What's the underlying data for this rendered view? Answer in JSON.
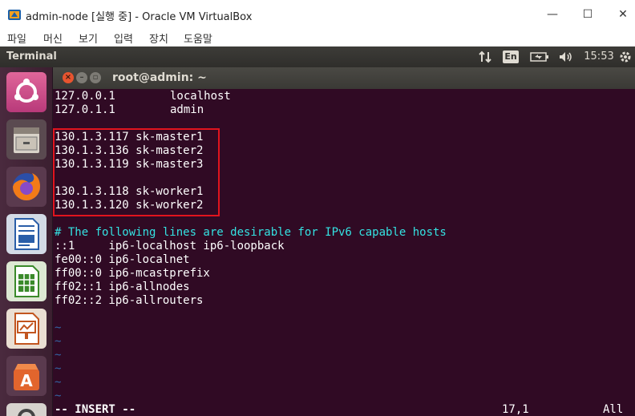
{
  "window": {
    "title": "admin-node [실행 중] - Oracle VM VirtualBox",
    "controls": {
      "minimize": "—",
      "maximize": "☐",
      "close": "✕"
    }
  },
  "menubar": {
    "items": [
      "파일",
      "머신",
      "보기",
      "입력",
      "장치",
      "도움말"
    ]
  },
  "panel": {
    "app_name": "Terminal",
    "keyboard_lang": "En",
    "clock": "15:53"
  },
  "launcher": {
    "items": [
      "ubuntu-dash-icon",
      "files-icon",
      "firefox-icon",
      "libreoffice-writer-icon",
      "libreoffice-calc-icon",
      "libreoffice-impress-icon",
      "software-center-icon",
      "settings-icon"
    ]
  },
  "terminal": {
    "title": "root@admin: ~",
    "hosts": [
      {
        "ip": "127.0.0.1",
        "name": "localhost"
      },
      {
        "ip": "127.0.1.1",
        "name": "admin"
      }
    ],
    "masters": [
      "130.1.3.117 sk-master1",
      "130.1.3.136 sk-master2",
      "130.1.3.119 sk-master3"
    ],
    "workers": [
      "130.1.3.118 sk-worker1",
      "130.1.3.120 sk-worker2"
    ],
    "ipv6_comment": "# The following lines are desirable for IPv6 capable hosts",
    "ipv6_lines": [
      "::1     ip6-localhost ip6-loopback",
      "fe00::0 ip6-localnet",
      "ff00::0 ip6-mcastprefix",
      "ff02::1 ip6-allnodes",
      "ff02::2 ip6-allrouters"
    ],
    "tilde": "~",
    "status": {
      "mode": "-- INSERT --",
      "position": "17,1",
      "scroll": "All"
    }
  },
  "colors": {
    "terminal_bg": "#300a24",
    "comment": "#34e2e2",
    "tilde": "#3465a4",
    "highlight": "#e1141e",
    "close_button": "#e8542f"
  }
}
